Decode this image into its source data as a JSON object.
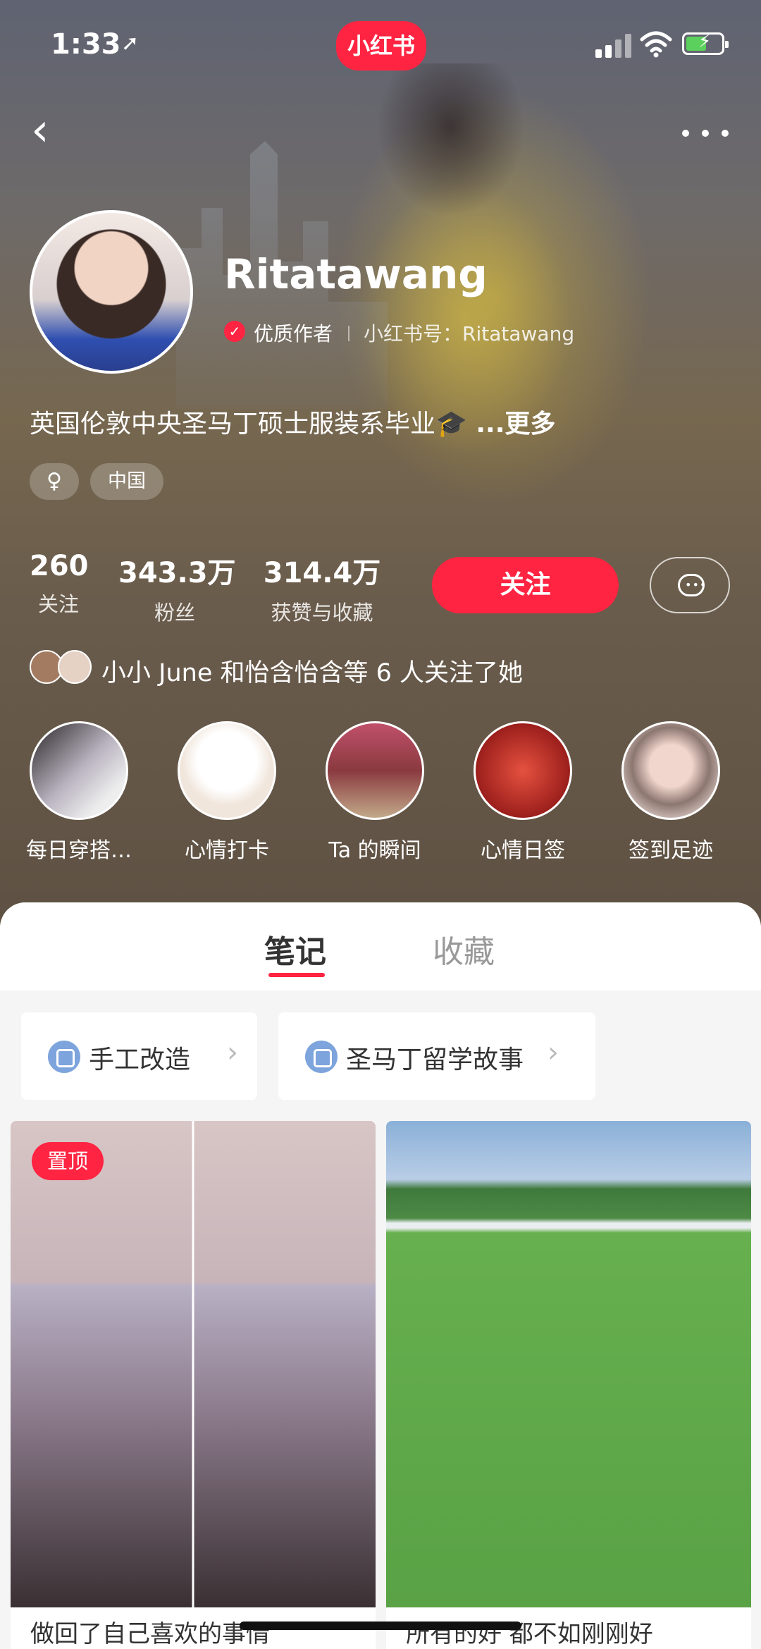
{
  "status_bar": {
    "time": "1:33",
    "location_icon": "location-arrow-icon",
    "app_badge": "小红书",
    "signal_icon": "cellular-signal-icon",
    "wifi_icon": "wifi-icon",
    "battery_icon": "battery-charging-icon"
  },
  "nav": {
    "back_icon": "chevron-left-icon",
    "more_icon": "more-dots-icon"
  },
  "profile": {
    "username": "Ritatawang",
    "quality_label": "优质作者",
    "account_id": "小红书号：Ritatawang",
    "bio": "英国伦敦中央圣马丁硕士服装系毕业🎓",
    "bio_more": " ...更多",
    "tags": {
      "gender": "♀",
      "region": "中国"
    }
  },
  "stats": [
    {
      "value": "260",
      "label": "关注"
    },
    {
      "value": "343.3万",
      "label": "粉丝"
    },
    {
      "value": "314.4万",
      "label": "获赞与收藏"
    }
  ],
  "actions": {
    "follow_label": "关注",
    "chat_icon": "chat-bubble-icon"
  },
  "mutual_followers": {
    "text": "小小 June 和怡含怡含等 6 人关注了她"
  },
  "highlights": [
    {
      "label": "每日穿搭…",
      "color": "#8a7f86"
    },
    {
      "label": "心情打卡",
      "color": "#f1e6dc"
    },
    {
      "label": "Ta 的瞬间",
      "color": "#a0505a"
    },
    {
      "label": "心情日签",
      "color": "#b8322c"
    },
    {
      "label": "签到足迹",
      "color": "#d9c8c3"
    }
  ],
  "tabs": [
    {
      "label": "笔记",
      "active": true
    },
    {
      "label": "收藏",
      "active": false
    }
  ],
  "collections": [
    {
      "label": "手工改造",
      "icon": "collection-icon"
    },
    {
      "label": "圣马丁留学故事",
      "icon": "collection-icon"
    }
  ],
  "notes": [
    {
      "pinned_label": "置顶",
      "title": "做回了自己喜欢的事情"
    },
    {
      "title": "所有的好 都不如刚刚好"
    }
  ],
  "colors": {
    "brand_red": "#ff2442"
  }
}
